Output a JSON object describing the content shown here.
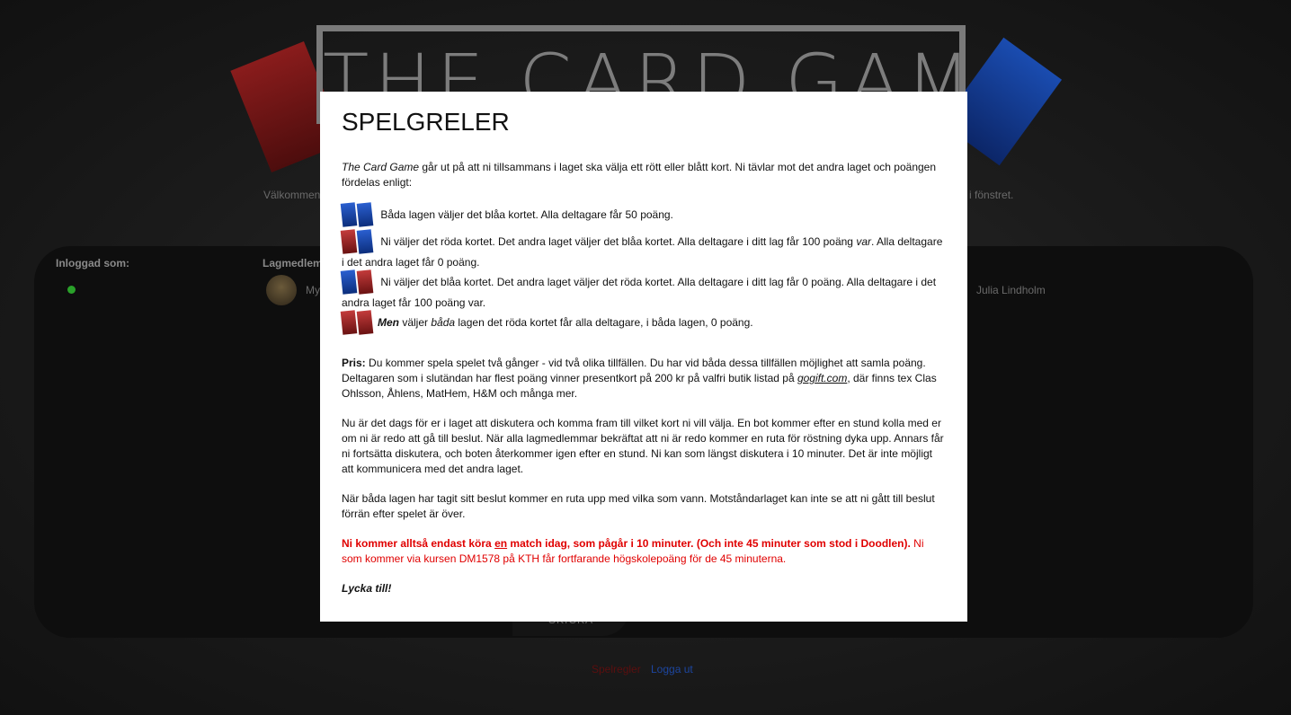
{
  "header": {
    "logo_text": "THE CARD GAME",
    "welcome_left": "Välkommen",
    "welcome_right": "d i fönstret."
  },
  "panel": {
    "logged_in_label": "Inloggad som:",
    "team_members_label": "Lagmedlem",
    "member_left": "My",
    "member_right": "Julia Lindholm",
    "send_button": "SKICKA"
  },
  "footer": {
    "red_link": "Spelregler",
    "logout_link": "Logga ut"
  },
  "modal": {
    "title": "SPELGRELER",
    "intro_game": "The Card Game",
    "intro_rest": " går ut på att ni tillsammans i laget ska välja ett rött eller blått kort. Ni tävlar mot det andra laget och poängen fördelas enligt:",
    "rule1": " Båda lagen väljer det blåa kortet. Alla deltagare får 50 poäng.",
    "rule2_a": " Ni väljer det röda kortet. Det andra laget väljer det blåa kortet. Alla deltagare i ditt lag får 100 poäng ",
    "rule2_var": "var",
    "rule2_b": ". Alla deltagare i det andra laget får 0 poäng.",
    "rule3": " Ni väljer det blåa kortet. Det andra laget väljer det röda kortet. Alla deltagare i ditt lag får 0 poäng. Alla deltagare i det andra laget får 100 poäng var.",
    "rule4_men": "Men",
    "rule4_a": " väljer ",
    "rule4_bada": "båda",
    "rule4_b": " lagen det röda kortet får alla deltagare, i båda lagen, 0 poäng.",
    "pris_label": "Pris:",
    "pris_text_a": " Du kommer spela spelet två gånger - vid två olika tillfällen. Du har vid båda dessa tillfällen möjlighet att samla poäng. Deltagaren som i slutändan har flest poäng vinner presentkort på 200 kr på valfri butik listad på ",
    "pris_link": "gogift.com",
    "pris_text_b": ", där finns tex Clas Ohlsson, Åhlens, MatHem, H&M och många mer.",
    "para_discuss": "Nu är det dags för er i laget att diskutera och komma fram till vilket kort ni vill välja. En bot kommer efter en stund kolla med er om ni är redo att gå till beslut. När alla lagmedlemmar bekräftat att ni är redo kommer en ruta för röstning dyka upp. Annars får ni fortsätta diskutera, och boten återkommer igen efter en stund. Ni kan som längst diskutera i 10 minuter. Det är inte möjligt att kommunicera med det andra laget.",
    "para_decision": "När båda lagen har tagit sitt beslut kommer en ruta upp med vilka som vann. Motståndarlaget kan inte se att ni gått till beslut förrän efter spelet är över.",
    "warn_bold_a": "Ni kommer alltså endast köra ",
    "warn_en": "en",
    "warn_bold_b": " match idag, som pågår i 10 minuter. (Och inte 45 minuter som stod i Doodlen).",
    "warn_rest": " Ni som kommer via kursen DM1578 på KTH får fortfarande högskolepoäng för de 45 minuterna.",
    "good_luck": "Lycka till!"
  },
  "colors": {
    "red_card": "#c33b3b",
    "blue_card": "#2a5fd0",
    "warning": "#e00000",
    "online": "#2aa12a"
  }
}
